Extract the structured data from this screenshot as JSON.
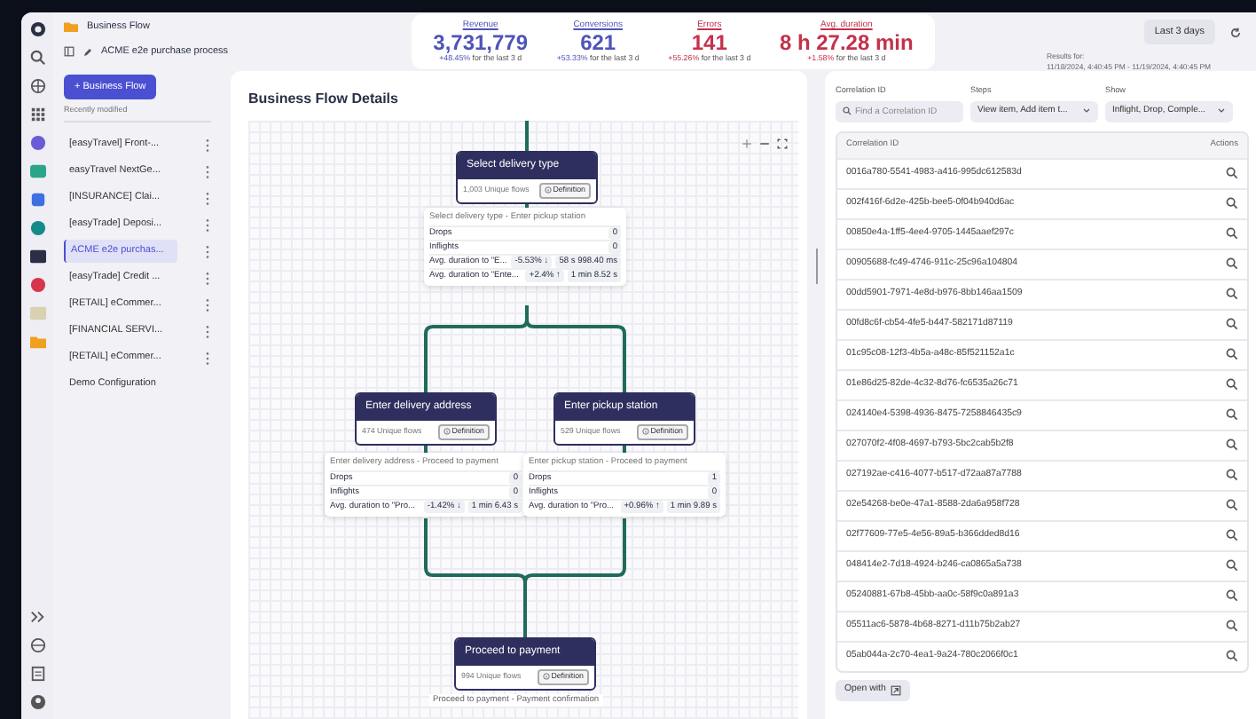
{
  "app": {
    "section": "Business Flow",
    "flow_name": "ACME e2e purchase process"
  },
  "kpis": [
    {
      "label": "Revenue",
      "value": "3,731,779",
      "change": "+48.45%",
      "period": "for the last 3 d",
      "color": "#4e54b8"
    },
    {
      "label": "Conversions",
      "value": "621",
      "change": "+53.33%",
      "period": "for the last 3 d",
      "color": "#4e54b8"
    },
    {
      "label": "Errors",
      "value": "141",
      "change": "+55.26%",
      "period": "for the last 3 d",
      "color": "#c4314b"
    },
    {
      "label": "Avg. duration",
      "value": "8 h 27.28 min",
      "change": "+1.58%",
      "period": "for the last 3 d",
      "color": "#c4314b"
    }
  ],
  "time": {
    "range_button": "Last 3 days",
    "results_label": "Results for:",
    "results_range": "11/18/2024, 4:40:45 PM - 11/19/2024, 4:40:45 PM"
  },
  "sidebar": {
    "new_button": "+ Business Flow",
    "section_label": "Recently modified",
    "items": [
      {
        "label": "[easyTravel] Front-...",
        "selected": false,
        "menu": true
      },
      {
        "label": "easyTravel NextGe...",
        "selected": false,
        "menu": true
      },
      {
        "label": "[INSURANCE] Clai...",
        "selected": false,
        "menu": true
      },
      {
        "label": "[easyTrade] Deposi...",
        "selected": false,
        "menu": true
      },
      {
        "label": "ACME e2e purchas...",
        "selected": true,
        "menu": true
      },
      {
        "label": "[easyTrade] Credit ...",
        "selected": false,
        "menu": true
      },
      {
        "label": "[RETAIL] eCommer...",
        "selected": false,
        "menu": true
      },
      {
        "label": "[FINANCIAL SERVI...",
        "selected": false,
        "menu": true
      },
      {
        "label": "[RETAIL] eCommer...",
        "selected": false,
        "menu": true
      },
      {
        "label": "Demo Configuration",
        "selected": false,
        "menu": false
      }
    ]
  },
  "details": {
    "title": "Business Flow Details",
    "nodes": [
      {
        "title": "Select delivery type",
        "flows": "1,003 Unique flows",
        "definition": "Definition"
      },
      {
        "title": "Enter delivery address",
        "flows": "474 Unique flows",
        "definition": "Definition"
      },
      {
        "title": "Enter pickup station",
        "flows": "529 Unique flows",
        "definition": "Definition"
      },
      {
        "title": "Proceed to payment",
        "flows": "994 Unique flows",
        "definition": "Definition"
      }
    ],
    "transitions": [
      {
        "title": "Select delivery type - Enter pickup station",
        "rows": [
          {
            "kind": "count",
            "label": "Drops",
            "value": "0"
          },
          {
            "kind": "count",
            "label": "Inflights",
            "value": "0"
          },
          {
            "kind": "duration",
            "label": "Avg. duration to \"E...",
            "change": "-5.53% ↓",
            "value": "58 s 998.40 ms"
          },
          {
            "kind": "duration",
            "label": "Avg. duration to \"Ente...",
            "change": "+2.4% ↑",
            "value": "1 min 8.52 s"
          }
        ]
      },
      {
        "title": "Enter delivery address - Proceed to payment",
        "rows": [
          {
            "kind": "count",
            "label": "Drops",
            "value": "0"
          },
          {
            "kind": "count",
            "label": "Inflights",
            "value": "0"
          },
          {
            "kind": "duration",
            "label": "Avg. duration to \"Pro...",
            "change": "-1.42% ↓",
            "value": "1 min 6.43 s"
          }
        ]
      },
      {
        "title": "Enter pickup station - Proceed to payment",
        "rows": [
          {
            "kind": "count",
            "label": "Drops",
            "value": "1"
          },
          {
            "kind": "count",
            "label": "Inflights",
            "value": "0"
          },
          {
            "kind": "duration",
            "label": "Avg. duration to \"Pro...",
            "change": "+0.96% ↑",
            "value": "1 min 9.89 s"
          }
        ]
      }
    ],
    "footer_label": "Proceed to payment - Payment confirmation"
  },
  "correlation": {
    "filters": [
      {
        "label": "Correlation ID",
        "kind": "search",
        "placeholder": "Find a Correlation ID"
      },
      {
        "label": "Steps",
        "kind": "select",
        "value": "View item, Add item t..."
      },
      {
        "label": "Show",
        "kind": "select",
        "value": "Inflight, Drop, Comple..."
      }
    ],
    "columns": [
      "Correlation ID",
      "Actions"
    ],
    "rows": [
      "0016a780-5541-4983-a416-995dc612583d",
      "002f416f-6d2e-425b-bee5-0f04b940d6ac",
      "00850e4a-1ff5-4ee4-9705-1445aaef297c",
      "00905688-fc49-4746-911c-25c96a104804",
      "00dd5901-7971-4e8d-b976-8bb146aa1509",
      "00fd8c6f-cb54-4fe5-b447-582171d87119",
      "01c95c08-12f3-4b5a-a48c-85f521152a1c",
      "01e86d25-82de-4c32-8d76-fc6535a26c71",
      "024140e4-5398-4936-8475-7258846435c9",
      "027070f2-4f08-4697-b793-5bc2cab5b2f8",
      "027192ae-c416-4077-b517-d72aa87a7788",
      "02e54268-be0e-47a1-8588-2da6a958f728",
      "02f77609-77e5-4e56-89a5-b366dded8d16",
      "048414e2-7d18-4924-b246-ca0865a5a738",
      "05240881-67b8-45bb-aa0c-58f9c0a891a3",
      "05511ac6-5878-4b68-8271-d11b75b2ab27",
      "05ab044a-2c70-4ea1-9a24-780c2066f0c1"
    ],
    "open_button": "Open with"
  }
}
